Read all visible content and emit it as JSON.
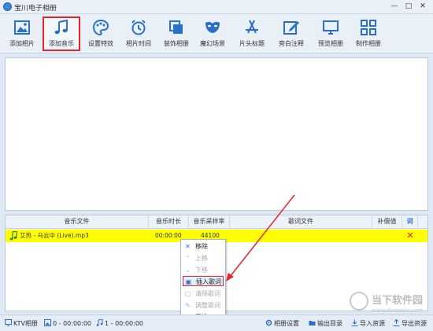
{
  "window": {
    "title": "宝川电子相册",
    "min": "—",
    "max": "□",
    "close": "✕"
  },
  "toolbar": {
    "items": [
      {
        "label": "添加相片",
        "icon": "photo-icon"
      },
      {
        "label": "添加音乐",
        "icon": "music-note-icon",
        "active": true
      },
      {
        "label": "设置特效",
        "icon": "palette-icon"
      },
      {
        "label": "相片时间",
        "icon": "alarm-clock-icon"
      },
      {
        "label": "装饰相册",
        "icon": "copy-frame-icon"
      },
      {
        "label": "魔幻场景",
        "icon": "mask-icon"
      },
      {
        "label": "片头标题",
        "icon": "app-store-icon"
      },
      {
        "label": "旁白注释",
        "icon": "edit-note-icon"
      },
      {
        "label": "预览相册",
        "icon": "monitor-icon"
      },
      {
        "label": "制作相册",
        "icon": "grid-icon"
      }
    ]
  },
  "table": {
    "headers": [
      "音乐文件",
      "音乐时长",
      "音乐采样率",
      "歌词文件",
      "补偿值",
      "词"
    ],
    "rows": [
      {
        "file": "艾热 - 乌云中 (Live).mp3",
        "duration": "00:00:00",
        "sample_rate": "44100",
        "lyric": "",
        "offset": "",
        "delete": "✕"
      }
    ]
  },
  "context_menu": {
    "items": [
      {
        "label": "移除",
        "icon": "✕",
        "enabled": true
      },
      {
        "label": "上移",
        "icon": "⌃",
        "enabled": false
      },
      {
        "label": "下移",
        "icon": "⌄",
        "enabled": false
      },
      {
        "label": "插入歌词",
        "icon": "▣",
        "enabled": true,
        "highlight": true
      },
      {
        "label": "清除歌词",
        "icon": "▢",
        "enabled": false
      },
      {
        "label": "调整歌词",
        "icon": "✎",
        "enabled": false
      },
      {
        "label": "属性",
        "icon": "⋯",
        "enabled": true
      }
    ]
  },
  "statusbar": {
    "album_type": "KTV相册",
    "photo_count": "0 - 00:00:00",
    "music_count": "1 - 00:00:00",
    "album_settings": "相册设置",
    "output_dir": "输出目录",
    "import_resource": "导入资源",
    "export_resource": "导出资源"
  },
  "watermark": {
    "text": "当下软件园",
    "url": "www.downxia.com"
  },
  "colors": {
    "accent": "#2a6fc9",
    "highlight_row": "#ffff00",
    "red": "#e8232a"
  }
}
